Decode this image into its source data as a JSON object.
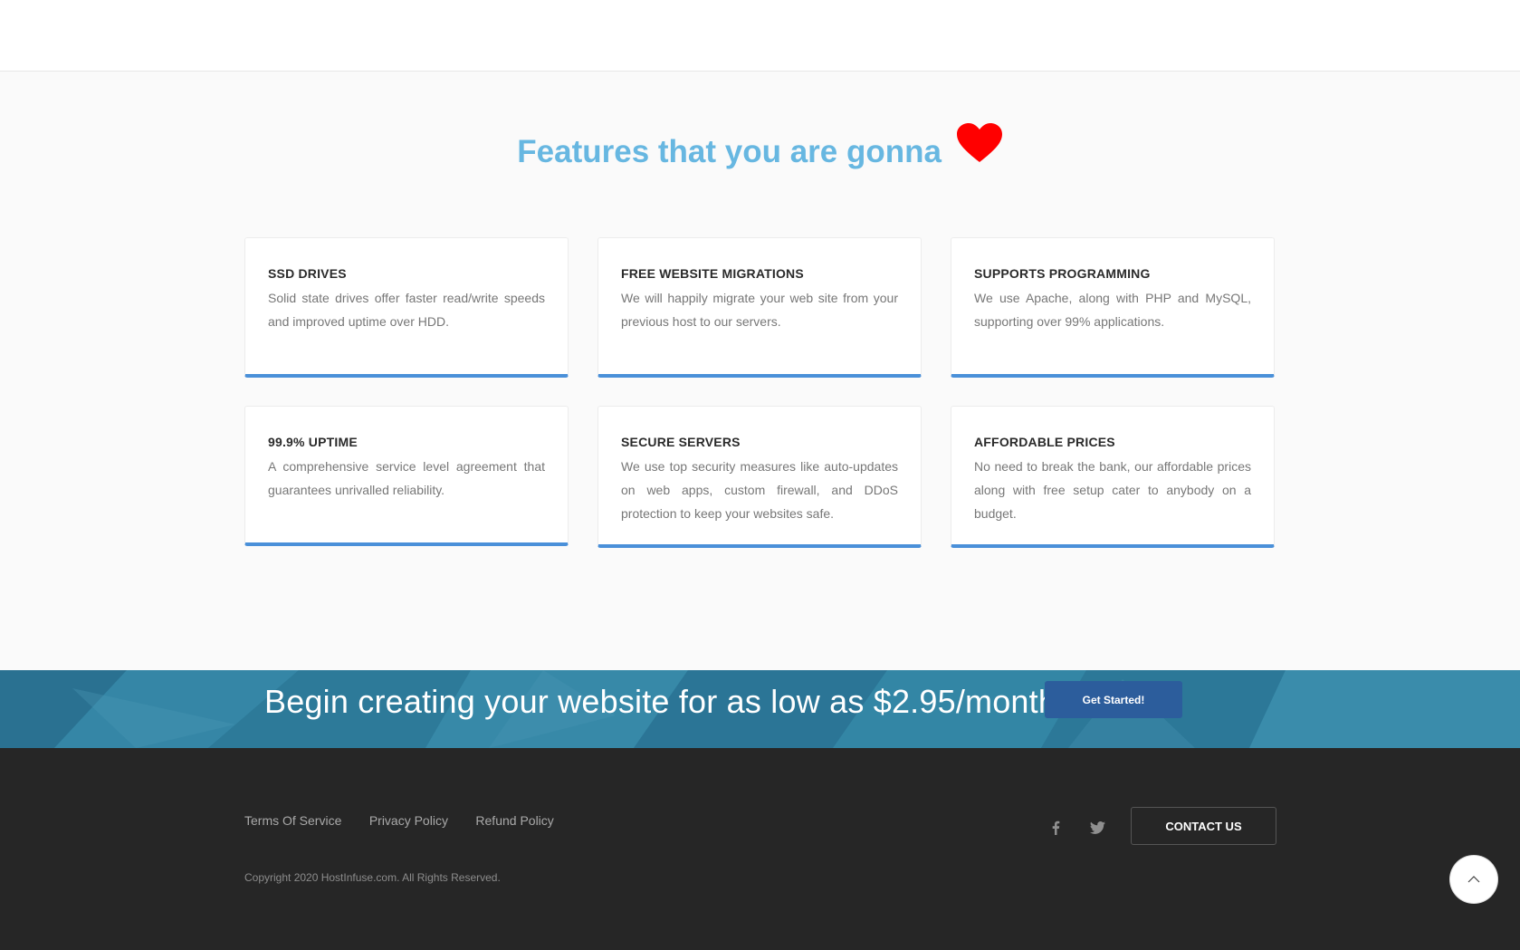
{
  "features": {
    "heading": "Features that you are gonna",
    "heart_icon": "heart-icon",
    "heart_color": "#ff0000",
    "heading_color": "#67b7e1",
    "accent_color": "#4a90d9",
    "cards": [
      {
        "title": "SSD DRIVES",
        "text": "Solid state drives offer faster read/write speeds and improved uptime over HDD."
      },
      {
        "title": "FREE WEBSITE MIGRATIONS",
        "text": "We will happily migrate your web site from your previous host to our servers."
      },
      {
        "title": "SUPPORTS PROGRAMMING",
        "text": "We use Apache, along with PHP and MySQL, supporting over 99% applications."
      },
      {
        "title": "99.9% UPTIME",
        "text": "A comprehensive service level agreement that guarantees unrivalled reliability."
      },
      {
        "title": "SECURE SERVERS",
        "text": "We use top security measures like auto-updates on web apps, custom firewall, and DDoS protection to keep your websites safe."
      },
      {
        "title": "AFFORDABLE PRICES",
        "text": "No need to break the bank, our affordable prices along with free setup cater to anybody on a budget."
      }
    ]
  },
  "cta": {
    "text": "Begin creating your website for as low as $2.95/month",
    "button_label": "Get Started!",
    "button_color": "#2c5d9c"
  },
  "footer": {
    "links": [
      "Terms Of Service",
      "Privacy Policy",
      "Refund Policy"
    ],
    "copyright": "Copyright 2020 HostInfuse.com. All Rights Reserved.",
    "social_icons": [
      "facebook-icon",
      "twitter-icon"
    ],
    "contact_label": "CONTACT US",
    "back_to_top_icon": "chevron-up-icon"
  }
}
